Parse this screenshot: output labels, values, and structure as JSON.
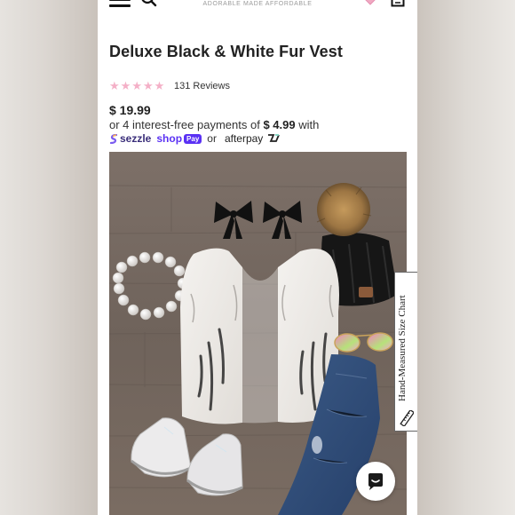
{
  "header": {
    "tagline": "ADORABLE MADE AFFORDABLE"
  },
  "product": {
    "title": "Deluxe Black & White Fur Vest",
    "rating_stars": 5,
    "reviews": "131 Reviews",
    "price": "$ 19.99",
    "installment_prefix": "or 4 interest-free payments of",
    "installment_amount": "$ 4.99",
    "installment_suffix": "with",
    "providers": {
      "sezzle": "sezzle",
      "shop": "shop",
      "shop_pay": "Pay",
      "or": "or",
      "afterpay": "afterpay"
    }
  },
  "size_chart_tab": "Hand-Measured Size Chart",
  "colors": {
    "star": "#f4b0c7",
    "shop_pay": "#5a31f4",
    "sezzle": "#3a2e7a",
    "wood_floor": "#7a6c62"
  },
  "icons": [
    "menu-icon",
    "search-icon",
    "heart-icon",
    "cart-icon",
    "star-icon",
    "sezzle-icon",
    "afterpay-icon",
    "ruler-icon",
    "chat-icon"
  ]
}
